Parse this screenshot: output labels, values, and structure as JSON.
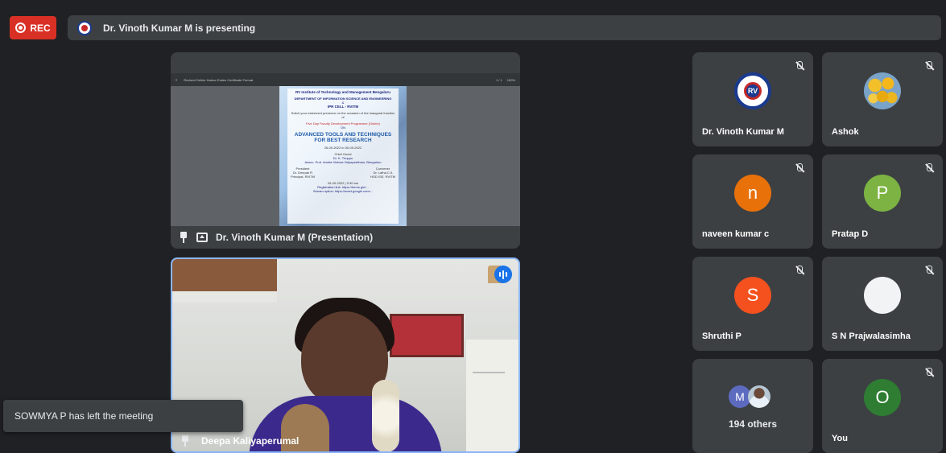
{
  "recording": {
    "label": "REC"
  },
  "banner": {
    "text": "Dr. Vinoth Kumar M is presenting"
  },
  "presentation": {
    "label": "Dr. Vinoth Kumar M (Presentation)",
    "viewer_title": "Revised Online Harbor Erstes Certificate Format",
    "page_indicator": "1 / 1",
    "zoom": "100%",
    "poster": {
      "institute": "RV Institute of Technology and Management Bengaluru",
      "department": "DEPARTMENT OF INFORMATION SCIENCE AND ENGINEERING",
      "amp": "&",
      "cell": "IPR CELL - RVITM",
      "invite": "Solicit your esteemed presence on the occasion of the inaugural function of",
      "fdp": "Five Day Faculty Development Programme (Online)",
      "on": "ON",
      "topic": "ADVANCED TOOLS AND TECHNIQUES FOR BEST RESEARCH",
      "dates": "26-09-2022 to 30-09-2022",
      "chief_guest_title": "Chief Guest",
      "chief_guest": "Dr. K. Tiruppu",
      "chief_guest_role": "Assoc. Prof. Amrita Vishwa Vidyapeetham, Bengaluru",
      "president_title": "President",
      "president": "Dr. Deepak R",
      "president_role": "Principal, RVITM",
      "convener_title": "Convener",
      "convener": "Dr. Latha C A",
      "convener_role": "HOD ISE, RVITM",
      "event_time": "26-09-2022 | 9:30 am",
      "reg_link": "Registration link: https://forms.gle/...",
      "stream_link": "Stream option: https://meet.google.com/..."
    }
  },
  "video": {
    "name": "Deepa Kaliyaperumal"
  },
  "notification": {
    "text": "SOWMYA P has left the meeting"
  },
  "participants": [
    {
      "name": "Dr. Vinoth Kumar M",
      "avatar": "rv-logo",
      "initial": "RV"
    },
    {
      "name": "Ashok",
      "avatar": "photo-flowers",
      "initial": ""
    },
    {
      "name": "naveen kumar c",
      "avatar": "letter",
      "initial": "n",
      "color": "#e8710a"
    },
    {
      "name": "Pratap D",
      "avatar": "letter",
      "initial": "P",
      "color": "#7cb342"
    },
    {
      "name": "Shruthi P",
      "avatar": "letter",
      "initial": "S",
      "color": "#f4511e"
    },
    {
      "name": "S N Prajwalasimha",
      "avatar": "blank",
      "initial": "",
      "color": "#f1f3f4"
    },
    {
      "name": "194 others",
      "avatar": "group",
      "initial": "M"
    },
    {
      "name": "You",
      "avatar": "letter",
      "initial": "O",
      "color": "#2e7d32"
    }
  ],
  "colors": {
    "accent": "#8ab4f8",
    "rec": "#d93025",
    "tile": "#3c4043",
    "background": "#202124"
  },
  "icons": [
    "mic-off-icon",
    "pin-icon",
    "present-icon",
    "speaking-icon",
    "rec-dot-icon"
  ]
}
